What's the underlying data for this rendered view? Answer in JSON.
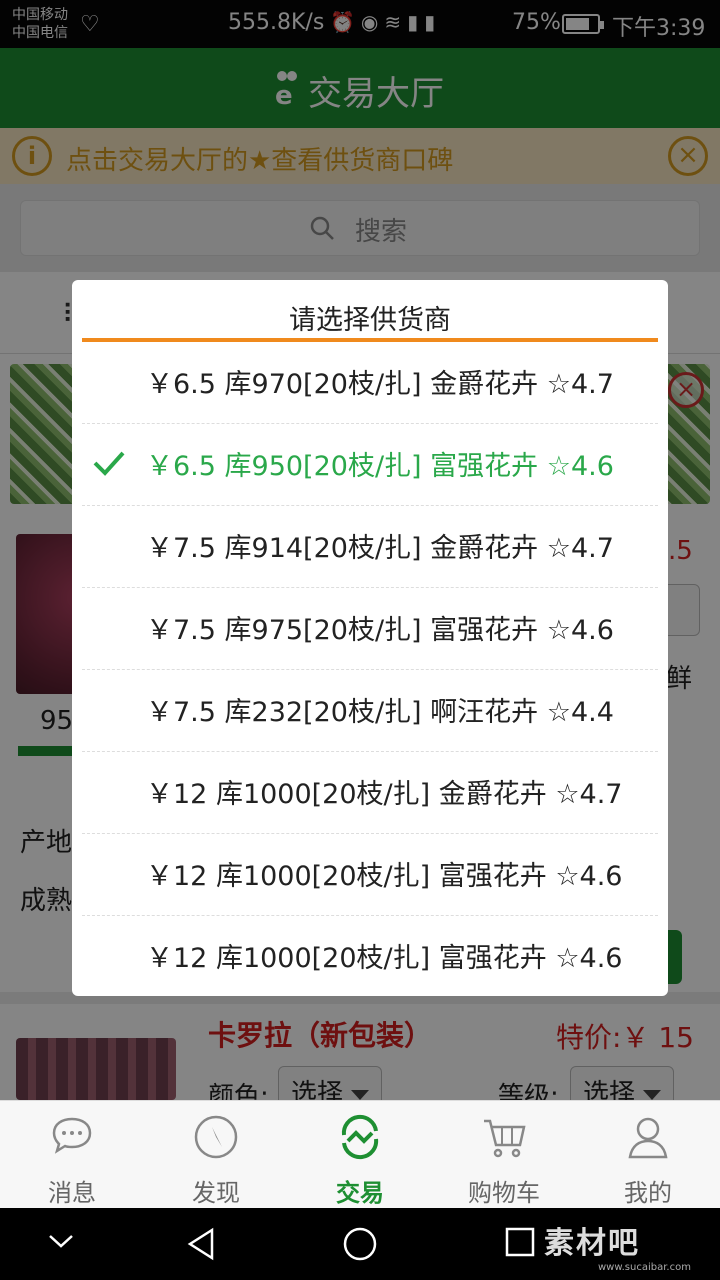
{
  "status_bar": {
    "carrier_1": "中国移动",
    "carrier_2": "中国电信",
    "net_speed": "555.8K/s",
    "battery": "75%",
    "battery_level": 0.75,
    "time": "下午3:39"
  },
  "header": {
    "title": "交易大厅"
  },
  "notice": {
    "text": "点击交易大厅的★查看供货商口碑"
  },
  "search": {
    "placeholder": "搜索"
  },
  "background_list": {
    "frag_price": ".5",
    "frag_fresh": "鲜",
    "frag_qty": "95",
    "frag_origin": "产地",
    "frag_mature": "成熟",
    "item2": {
      "name": "卡罗拉（新包装）",
      "price": "特价:￥ 15",
      "color_label": "颜色:",
      "color_value": "选择",
      "grade_label": "等级:",
      "grade_value": "选择"
    }
  },
  "dialog": {
    "title": "请选择供货商",
    "options": [
      {
        "text": "￥6.5 库970[20枝/扎] 金爵花卉 ☆4.7",
        "selected": false
      },
      {
        "text": "￥6.5 库950[20枝/扎] 富强花卉 ☆4.6",
        "selected": true
      },
      {
        "text": "￥7.5 库914[20枝/扎] 金爵花卉 ☆4.7",
        "selected": false
      },
      {
        "text": "￥7.5 库975[20枝/扎] 富强花卉 ☆4.6",
        "selected": false
      },
      {
        "text": "￥7.5 库232[20枝/扎] 啊汪花卉 ☆4.4",
        "selected": false
      },
      {
        "text": "￥12 库1000[20枝/扎] 金爵花卉 ☆4.7",
        "selected": false
      },
      {
        "text": "￥12 库1000[20枝/扎] 富强花卉 ☆4.6",
        "selected": false
      },
      {
        "text": "￥12 库1000[20枝/扎] 富强花卉 ☆4.6",
        "selected": false
      }
    ]
  },
  "tabs": [
    {
      "label": "消息",
      "icon": "chat-icon",
      "active": false
    },
    {
      "label": "发现",
      "icon": "compass-icon",
      "active": false
    },
    {
      "label": "交易",
      "icon": "trade-icon",
      "active": true
    },
    {
      "label": "购物车",
      "icon": "cart-icon",
      "active": false
    },
    {
      "label": "我的",
      "icon": "user-icon",
      "active": false
    }
  ],
  "watermark": {
    "main": "素材吧",
    "sub": "www.sucaibar.com"
  },
  "colors": {
    "brand_green": "#1e8f32",
    "accent_orange": "#f08a1d",
    "notice_text": "#d49a1f",
    "price_red": "#d32020"
  }
}
